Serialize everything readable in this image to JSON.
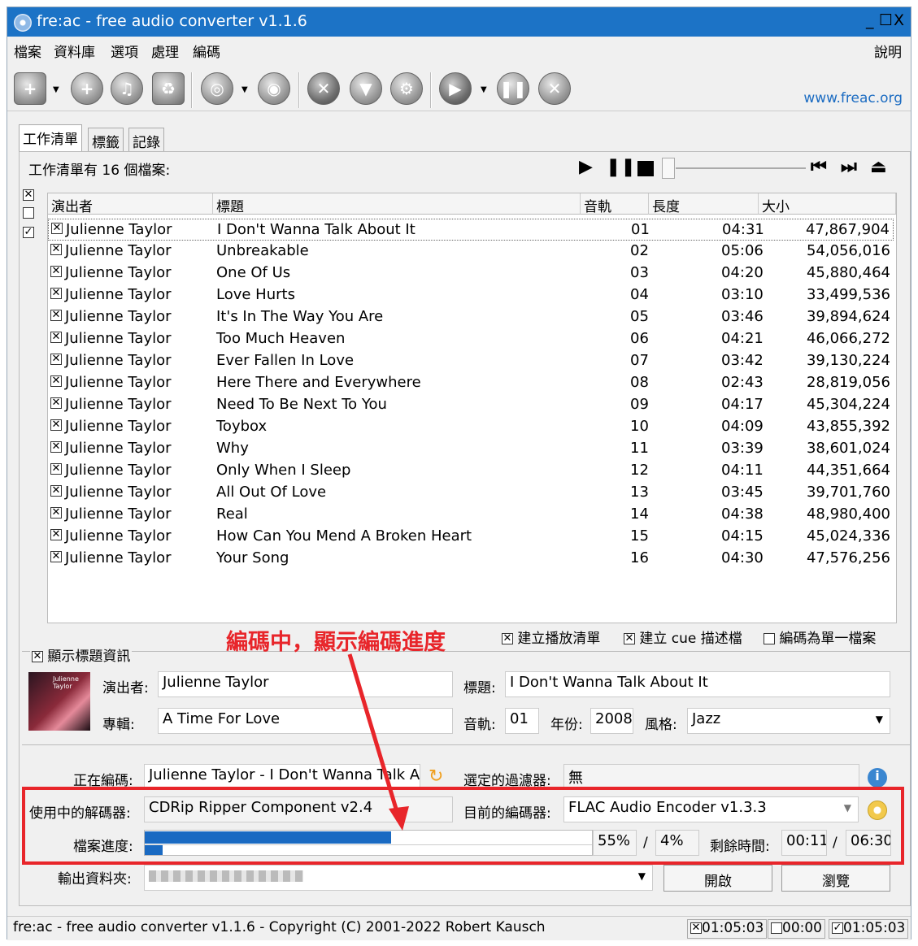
{
  "window": {
    "title": "fre:ac - free audio converter v1.1.6",
    "min": "_",
    "max": "☐",
    "close": "X"
  },
  "menu": {
    "items": [
      "檔案",
      "資料庫",
      "選項",
      "處理",
      "編碼"
    ],
    "help": "說明"
  },
  "toolbar": {
    "link": "www.freac.org"
  },
  "tabs": [
    "工作清單",
    "標籤",
    "記錄"
  ],
  "joblist": {
    "count_text": "工作清單有 16 個檔案:",
    "columns": [
      "演出者",
      "標題",
      "音軌",
      "長度",
      "大小"
    ],
    "rows": [
      {
        "artist": "Julienne Taylor",
        "title": "I Don't Wanna Talk About It",
        "track": "01",
        "length": "04:31",
        "size": "47,867,904"
      },
      {
        "artist": "Julienne Taylor",
        "title": "Unbreakable",
        "track": "02",
        "length": "05:06",
        "size": "54,056,016"
      },
      {
        "artist": "Julienne Taylor",
        "title": "One Of Us",
        "track": "03",
        "length": "04:20",
        "size": "45,880,464"
      },
      {
        "artist": "Julienne Taylor",
        "title": "Love Hurts",
        "track": "04",
        "length": "03:10",
        "size": "33,499,536"
      },
      {
        "artist": "Julienne Taylor",
        "title": "It's In The Way You Are",
        "track": "05",
        "length": "03:46",
        "size": "39,894,624"
      },
      {
        "artist": "Julienne Taylor",
        "title": "Too Much Heaven",
        "track": "06",
        "length": "04:21",
        "size": "46,066,272"
      },
      {
        "artist": "Julienne Taylor",
        "title": "Ever Fallen In Love",
        "track": "07",
        "length": "03:42",
        "size": "39,130,224"
      },
      {
        "artist": "Julienne Taylor",
        "title": "Here There and Everywhere",
        "track": "08",
        "length": "02:43",
        "size": "28,819,056"
      },
      {
        "artist": "Julienne Taylor",
        "title": "Need To Be Next To You",
        "track": "09",
        "length": "04:17",
        "size": "45,304,224"
      },
      {
        "artist": "Julienne Taylor",
        "title": "Toybox",
        "track": "10",
        "length": "04:09",
        "size": "43,855,392"
      },
      {
        "artist": "Julienne Taylor",
        "title": "Why",
        "track": "11",
        "length": "03:39",
        "size": "38,601,024"
      },
      {
        "artist": "Julienne Taylor",
        "title": "Only When I Sleep",
        "track": "12",
        "length": "04:11",
        "size": "44,351,664"
      },
      {
        "artist": "Julienne Taylor",
        "title": "All Out Of Love",
        "track": "13",
        "length": "03:45",
        "size": "39,701,760"
      },
      {
        "artist": "Julienne Taylor",
        "title": "Real",
        "track": "14",
        "length": "04:38",
        "size": "48,980,400"
      },
      {
        "artist": "Julienne Taylor",
        "title": "How Can You Mend A Broken Heart",
        "track": "15",
        "length": "04:15",
        "size": "45,024,336"
      },
      {
        "artist": "Julienne Taylor",
        "title": "Your Song",
        "track": "16",
        "length": "04:30",
        "size": "47,576,256"
      }
    ]
  },
  "options": {
    "playlist": "建立播放清單",
    "cue": "建立 cue 描述檔",
    "single": "編碼為單一檔案"
  },
  "annotation": "編碼中，顯示編碼進度",
  "taginfo": {
    "toggle": "顯示標題資訊",
    "artist_label": "演出者:",
    "artist": "Julienne Taylor",
    "title_label": "標題:",
    "title": "I Don't Wanna Talk About It",
    "album_label": "專輯:",
    "album": "A Time For Love",
    "track_label": "音軌:",
    "track": "01",
    "year_label": "年份:",
    "year": "2008",
    "genre_label": "風格:",
    "genre": "Jazz",
    "cover_text": "Julienne Taylor"
  },
  "encoding": {
    "now_label": "正在編碼:",
    "now": "Julienne Taylor - I Don't Wanna Talk Ab",
    "filter_label": "選定的過濾器:",
    "filter": "無",
    "decoder_label": "使用中的解碼器:",
    "decoder": "CDRip Ripper Component v2.4",
    "encoder_label": "目前的編碼器:",
    "encoder": "FLAC Audio Encoder v1.3.3",
    "progress_label": "檔案進度:",
    "file_pct": "55%",
    "sep": "/",
    "total_pct": "4%",
    "file_progress": 0.55,
    "total_progress": 0.04,
    "remain_label": "剩餘時間:",
    "remain": "00:11",
    "total_time": "06:30",
    "output_label": "輸出資料夾:",
    "open": "開啟",
    "browse": "瀏覽"
  },
  "status": {
    "text": "fre:ac - free audio converter v1.1.6 - Copyright (C) 2001-2022 Robert Kausch",
    "t1": "01:05:03",
    "t2": "00:00",
    "t3": "01:05:03"
  }
}
